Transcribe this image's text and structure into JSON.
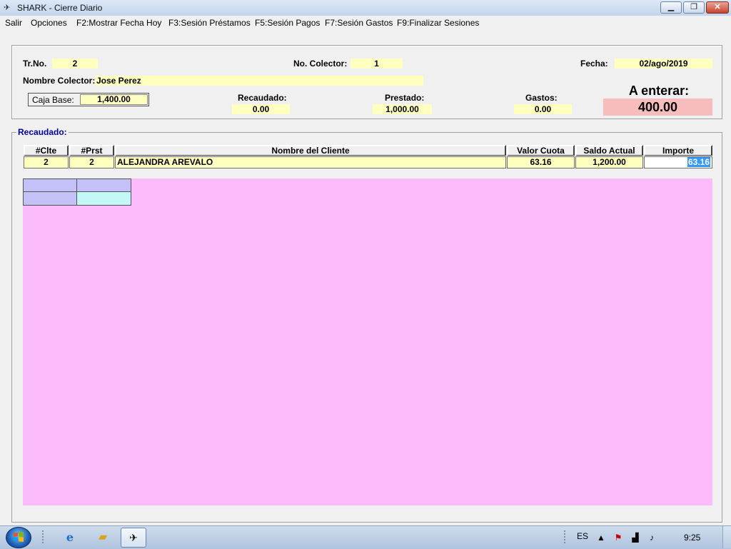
{
  "window": {
    "title": "SHARK - Cierre Diario",
    "min_glyph": "▁",
    "max_glyph": "❐",
    "close_glyph": "✕"
  },
  "menu": {
    "items": [
      {
        "label": "Salir"
      },
      {
        "label": "Opciones"
      },
      {
        "label": "F2:Mostrar Fecha Hoy"
      },
      {
        "label": "F3:Sesión Préstamos"
      },
      {
        "label": "F5:Sesión Pagos"
      },
      {
        "label": "F7:Sesión Gastos"
      },
      {
        "label": "F9:Finalizar Sesiones"
      }
    ]
  },
  "header": {
    "tr_no_label": "Tr.No.",
    "tr_no": "2",
    "collector_no_label": "No. Colector:",
    "collector_no": "1",
    "date_label": "Fecha:",
    "date": "02/ago/2019",
    "collector_name_label": "Nombre Colector:",
    "collector_name": "Jose Perez",
    "caja_base_label": "Caja Base:",
    "caja_base": "1,400.00",
    "recaudado_label": "Recaudado:",
    "recaudado": "0.00",
    "prestado_label": "Prestado:",
    "prestado": "1,000.00",
    "gastos_label": "Gastos:",
    "gastos": "0.00",
    "enterar_label": "A enterar:",
    "enterar": "400.00"
  },
  "recaudado_group": {
    "title": "Recaudado:",
    "columns": [
      "#Clte",
      "#Prst",
      "Nombre del Cliente",
      "Valor Cuota",
      "Saldo Actual",
      "Importe"
    ],
    "row": {
      "clte": "2",
      "prst": "2",
      "cliente": "ALEJANDRA AREVALO",
      "valor_cuota": "63.16",
      "saldo_actual": "1,200.00",
      "importe": "63.16"
    }
  },
  "colors": {
    "field_bg": "#ffffc0",
    "pink_area": "#fcbcfc",
    "enterar_bg": "#f7bcbc",
    "group_title": "#0000a0",
    "mini_grid_lavender": "#c4c0f8",
    "mini_grid_cyan": "#c4f8f8"
  },
  "taskbar": {
    "icons": [
      "windows-start-icon",
      "ie-icon",
      "folder-icon",
      "shark-app-icon"
    ],
    "language": "ES",
    "clock": "9:25"
  }
}
